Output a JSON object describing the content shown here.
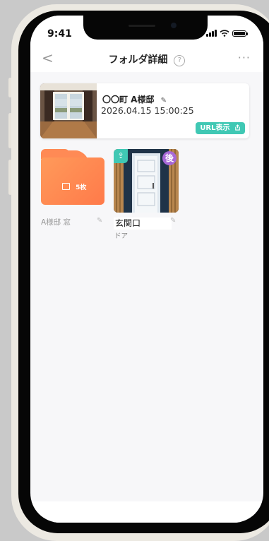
{
  "status_bar": {
    "time": "9:41"
  },
  "nav": {
    "back": "<",
    "title": "フォルダ詳細",
    "help": "?",
    "more": "···"
  },
  "folder_card": {
    "name": "〇〇町 A様邸",
    "datetime": "2026.04.15 15:00:25",
    "url_button": "URL表示"
  },
  "items": [
    {
      "kind": "folder",
      "count": "5枚",
      "caption": "A様邸 窓"
    },
    {
      "kind": "photo",
      "caption": "玄関口",
      "sub": "ドア",
      "badge_later": "後"
    }
  ],
  "colors": {
    "accent_teal": "#40c8b4",
    "folder_orange": "#ff8a55",
    "badge_purple": "#a768d6"
  },
  "icons": [
    "back-chevron-icon",
    "help-circle-icon",
    "more-dots-icon",
    "pencil-icon",
    "share-icon",
    "image-icon",
    "signal-icon",
    "wifi-icon",
    "battery-icon"
  ]
}
